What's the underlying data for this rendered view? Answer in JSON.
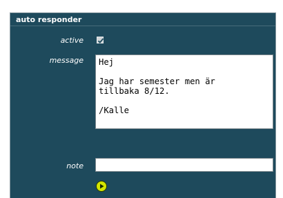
{
  "panel": {
    "title": "auto responder"
  },
  "fields": {
    "active_label": "active",
    "active_checked": true,
    "message_label": "message",
    "message_value": "Hej\n\nJag har semester men är\ntillbaka 8/12.\n\n/Kalle",
    "note_label": "note",
    "note_value": ""
  },
  "icons": {
    "checkbox": "check-icon",
    "submit": "play-arrow-icon"
  },
  "colors": {
    "panel_bg": "#1e4a5c",
    "submit_button": "#d4e600"
  }
}
